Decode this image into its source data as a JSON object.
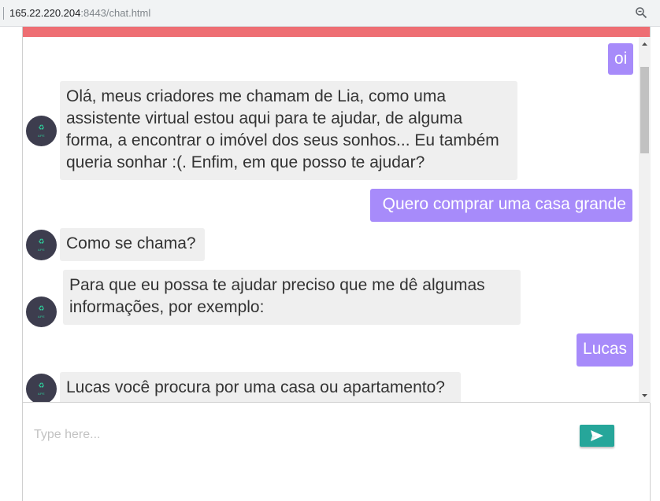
{
  "browser": {
    "url_host": "165.22.220.204",
    "url_rest": ":8443/chat.html",
    "zoom_icon": "zoom-icon"
  },
  "chat": {
    "accent_color": "#ee6e73",
    "user_bubble_color": "#a78bfa",
    "bot_bubble_color": "#efefef",
    "avatar_icon": "bot-avatar-icon",
    "avatar_label": "APE",
    "messages": [
      {
        "sender": "user",
        "text": "oi"
      },
      {
        "sender": "bot",
        "text": "Olá, meus criadores me chamam de Lia, como uma assistente virtual estou aqui para te ajudar, de alguma forma, a encontrar o imóvel dos seus sonhos... Eu também queria sonhar :(. Enfim, em que posso te ajudar?"
      },
      {
        "sender": "user",
        "text": "Quero comprar uma casa grande"
      },
      {
        "sender": "bot",
        "text": "Como se chama?"
      },
      {
        "sender": "bot",
        "text": "Para que eu possa te ajudar preciso que me dê algumas informações, por exemplo:"
      },
      {
        "sender": "user",
        "text": "Lucas"
      },
      {
        "sender": "bot",
        "text": "Lucas você procura por uma casa ou apartamento?"
      }
    ]
  },
  "composer": {
    "placeholder": "Type here...",
    "value": "",
    "send_icon": "send-icon",
    "send_color": "#26a69a"
  }
}
